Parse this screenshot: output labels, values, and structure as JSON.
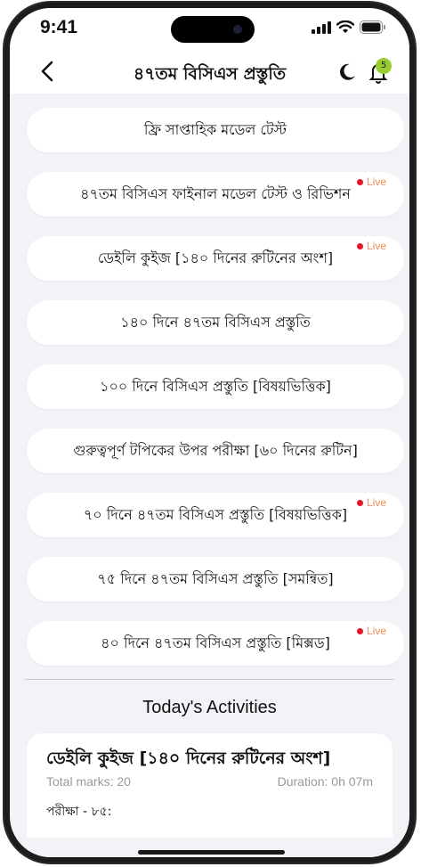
{
  "status_bar": {
    "time": "9:41"
  },
  "header": {
    "title": "৪৭তম বিসিএস প্রস্তুতি",
    "notification_count": "5"
  },
  "items": [
    {
      "label": "ফ্রি সাপ্তাহিক মডেল টেস্ট",
      "live": false
    },
    {
      "label": "৪৭তম বিসিএস ফাইনাল মডেল টেস্ট ও রিভিশন",
      "live": true
    },
    {
      "label": "ডেইলি কুইজ [১৪০ দিনের রুটিনের অংশ]",
      "live": true
    },
    {
      "label": "১৪০ দিনে ৪৭তম বিসিএস প্রস্তুতি",
      "live": false
    },
    {
      "label": "১০০ দিনে বিসিএস প্রস্তুতি [বিষয়ভিত্তিক]",
      "live": false
    },
    {
      "label": "গুরুত্বপূর্ণ টপিকের উপর পরীক্ষা [৬০ দিনের রুটিন]",
      "live": false
    },
    {
      "label": "৭০ দিনে ৪৭তম বিসিএস প্রস্তুতি [বিষয়ভিত্তিক]",
      "live": true
    },
    {
      "label": "৭৫ দিনে ৪৭তম বিসিএস প্রস্তুতি [সমন্বিত]",
      "live": false
    },
    {
      "label": "৪০ দিনে ৪৭তম বিসিএস প্রস্তুতি [মিক্সড]",
      "live": true
    }
  ],
  "live_label": "Live",
  "activities": {
    "heading": "Today's Activities",
    "card": {
      "title": "ডেইলি কুইজ [১৪০ দিনের রুটিনের অংশ]",
      "total_marks": "Total marks: 20",
      "duration": "Duration: 0h 07m",
      "subtitle": "পরীক্ষা - ৮৫:"
    }
  },
  "colors": {
    "background": "#f2f2f7",
    "live_dot": "#e8142d",
    "live_text": "#f08c5a",
    "badge": "#9acd32"
  }
}
